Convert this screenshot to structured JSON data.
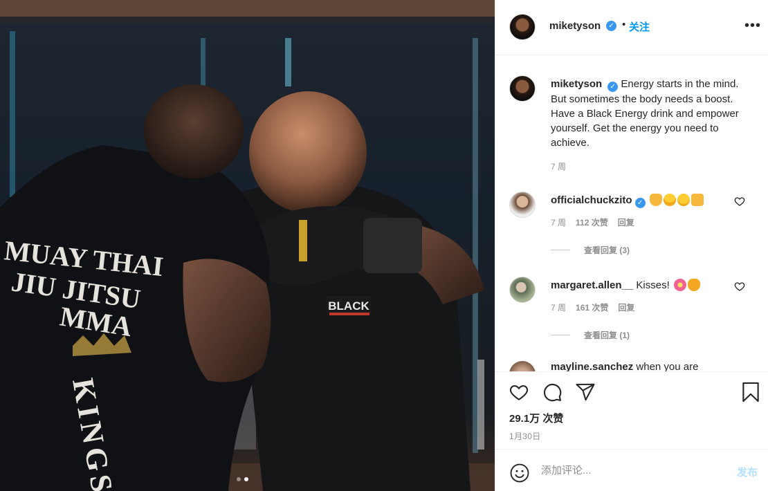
{
  "post": {
    "username": "miketyson",
    "follow_label": "关注",
    "more_icon": "more-horizontal-icon",
    "verified_icon": "verified-badge-icon",
    "separator": "•"
  },
  "photo": {
    "shirt_lines": [
      "MUAY THAI",
      "JIU JITSU",
      "MMA"
    ],
    "shirt_vertical": "KINGS",
    "brand_patch": "BLACK",
    "carousel_count": 2,
    "carousel_active": 2
  },
  "caption": {
    "username": "miketyson",
    "text": "Energy starts in the mind. But sometimes the body needs a boost. Have a Black Energy drink and empower yourself. Get the energy you need to achieve.",
    "time": "7 周"
  },
  "comments": [
    {
      "username": "officialchuckzito",
      "verified": true,
      "text": "",
      "emojis": [
        "folded-hands",
        "smiling-face",
        "hugging-face",
        "thumbs-up"
      ],
      "time": "7 周",
      "likes": "112 次赞",
      "reply_label": "回复",
      "view_replies": "查看回复 (3)"
    },
    {
      "username": "margaret.allen__",
      "verified": false,
      "text": "Kisses!",
      "emojis": [
        "hibiscus",
        "star-struck-cat"
      ],
      "time": "7 周",
      "likes": "161 次赞",
      "reply_label": "回复",
      "view_replies": "查看回复 (1)"
    }
  ],
  "partial_comment": {
    "username": "mayline.sanchez",
    "text": "when you are"
  },
  "actions": {
    "like_icon": "heart-icon",
    "comment_icon": "comment-icon",
    "share_icon": "send-icon",
    "save_icon": "bookmark-icon"
  },
  "likes_count": "29.1万 次赞",
  "post_date": "1月30日",
  "comment_box": {
    "placeholder": "添加评论...",
    "post_label": "发布",
    "emoji_icon": "smiley-icon"
  },
  "colors": {
    "accent": "#0095f6",
    "verified": "#3897f0",
    "muted": "#8e8e8e",
    "post_disabled": "#b2dffc"
  }
}
